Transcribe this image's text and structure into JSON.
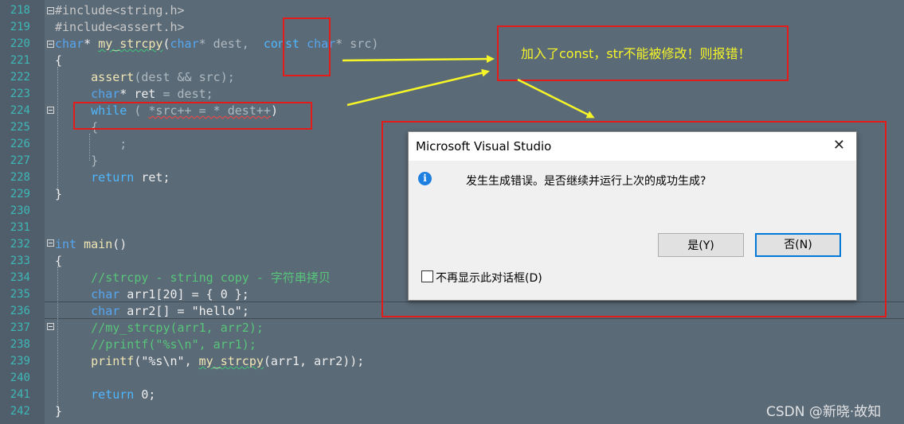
{
  "editor": {
    "line_numbers": [
      "218",
      "219",
      "220",
      "221",
      "222",
      "223",
      "224",
      "225",
      "226",
      "227",
      "228",
      "229",
      "230",
      "231",
      "232",
      "233",
      "234",
      "235",
      "236",
      "237",
      "238",
      "239",
      "240",
      "241",
      "242"
    ],
    "code": {
      "l218_a": "#include",
      "l218_b": "<string.h>",
      "l219_a": "#include",
      "l219_b": "<assert.h>",
      "l220_char1": "char",
      "l220_star": "* ",
      "l220_fn": "my_strcpy",
      "l220_paren": "(",
      "l220_char2": "char",
      "l220_dest": "* dest,  ",
      "l220_const": "const",
      "l220_char3": "char",
      "l220_src": "* src)",
      "l221": "{",
      "l222_fn": "assert",
      "l222_args": "(dest && src);",
      "l223_char": "char",
      "l223_rest": "* ",
      "l223_ret": "ret",
      "l223_tail": " = dest;",
      "l224_while": "while",
      "l224_open": " ( ",
      "l224_expr1": "*src++ = * dest++",
      "l224_close": ")",
      "l225": "{",
      "l226": ";",
      "l227": "}",
      "l228_return": "return",
      "l228_rest": " ret;",
      "l229": "}",
      "l232_int": "int",
      "l232_main": " main",
      "l232_paren": "()",
      "l233": "{",
      "l234_comment": "//strcpy - string copy - 字符串拷贝",
      "l235_char": "char",
      "l235_rest": " arr1[20] = { 0 };",
      "l236_char": "char",
      "l236_rest": " arr2[] = ",
      "l236_str": "\"hello\"",
      "l236_semi": ";",
      "l237_comment": "//my_strcpy(arr1, arr2);",
      "l238_comment": "//printf(\"%s\\n\", arr1);",
      "l239_printf": "printf",
      "l239_open": "(",
      "l239_str": "\"%s\\n\"",
      "l239_comma": ", ",
      "l239_fn": "my_strcpy",
      "l239_args": "(arr1, arr2));",
      "l241_return": "return",
      "l241_rest": " 0;",
      "l242": "}"
    }
  },
  "annotation": {
    "callout_text": "加入了const，str不能被修改！则报错！"
  },
  "dialog": {
    "title": "Microsoft Visual Studio",
    "close_glyph": "✕",
    "info_glyph": "i",
    "message": "发生生成错误。是否继续并运行上次的成功生成?",
    "yes_label": "是(Y)",
    "no_label": "否(N)",
    "checkbox_label": "不再显示此对话框(D)"
  },
  "watermark": "CSDN @新晓·故知",
  "colors": {
    "editor_bg": "#5b6a77",
    "annotation_red": "#e21b1b",
    "annotation_yellow": "#f5f528",
    "line_number": "#3fb7b7"
  }
}
